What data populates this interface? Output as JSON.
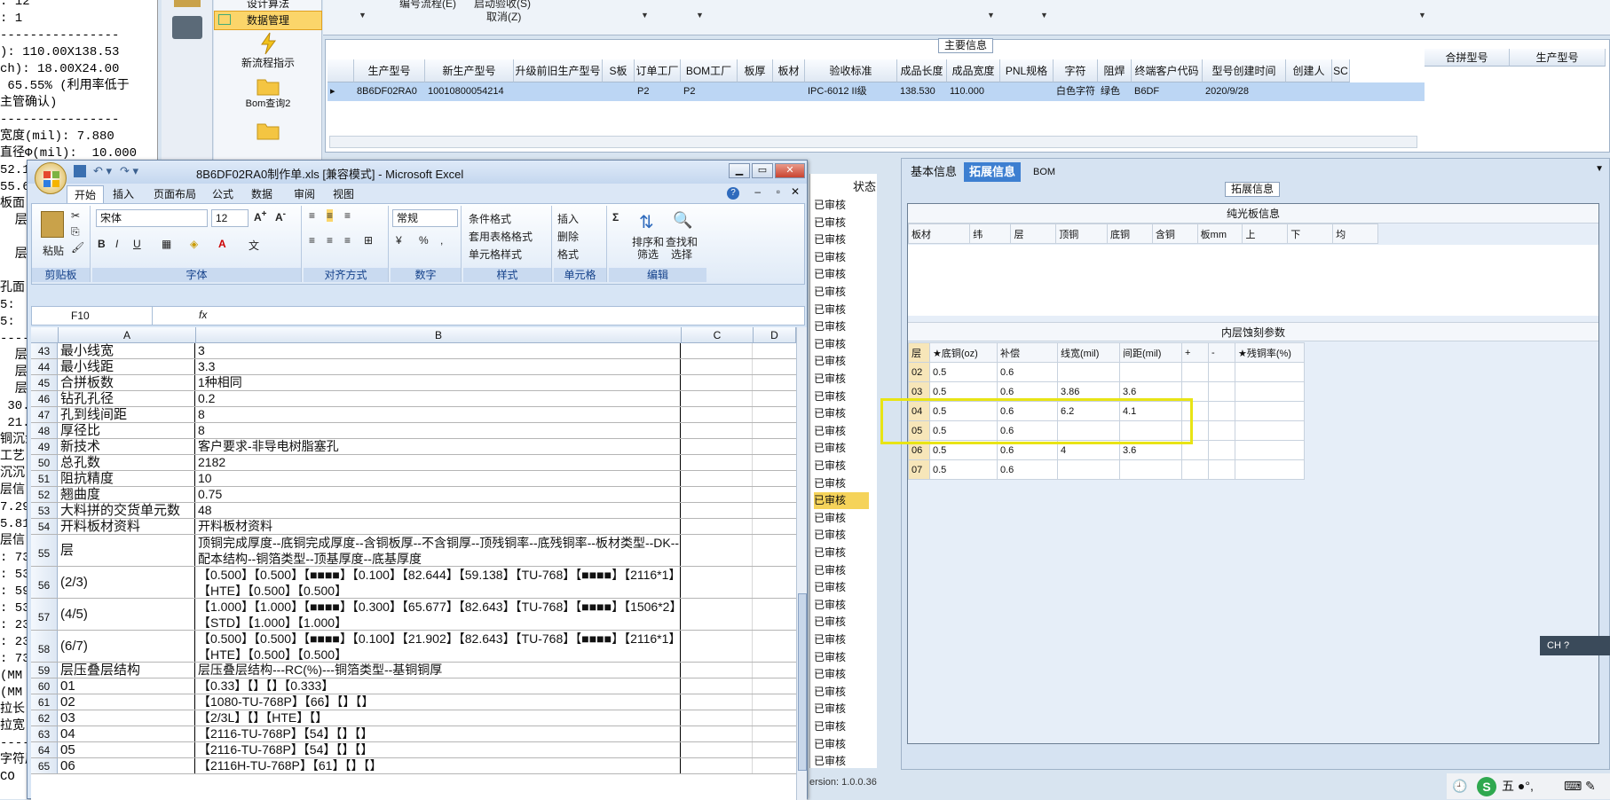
{
  "log": {
    "lines": [
      ": 12",
      ": 1",
      "----------------",
      "): 110.00X138.53",
      "ch): 18.00X24.00",
      " 65.55% (利用率低于",
      "主管确认)",
      "----------------",
      "宽度(mil): 7.880",
      "直径Φ(mil):  10.000",
      "52.1",
      "55.6",
      "板面",
      "  层",
      "",
      "  层",
      "",
      "孔面",
      "5:",
      "5:",
      "----",
      "  层",
      "  层",
      "  层",
      " 30.",
      " 21.",
      "铜沉金",
      "工艺",
      "沉沉",
      "层信",
      "7.29",
      "5.81",
      "层信",
      ": 73",
      ": 53",
      ": 59",
      ": 53",
      ": 23",
      ": 23",
      ": 73",
      "(MM",
      "(MM",
      "拉长",
      "拉宽",
      "----",
      "字符层",
      "CO"
    ]
  },
  "nav": {
    "items": [
      {
        "label": "设计算法"
      },
      {
        "label": "数据管理"
      },
      {
        "label": "新流程指示"
      },
      {
        "label": "Bom查询2"
      }
    ]
  },
  "toolbar": {
    "item1": "编号流程(E)",
    "item2": "启动验收(S)",
    "item3": "取消(Z)"
  },
  "main": {
    "section_title": "主要信息",
    "columns": [
      "生产型号",
      "新生产型号",
      "升级前旧生产型号",
      "S板",
      "订单工厂",
      "BOM工厂",
      "板厚",
      "板材",
      "验收标准",
      "成品长度",
      "成品宽度",
      "PNL规格",
      "字符",
      "阻焊",
      "终端客户代码",
      "型号创建时间",
      "创建人",
      "SC"
    ],
    "row": [
      "8B6DF02RA0",
      "10010800054214",
      "",
      "",
      "P2",
      "P2",
      "",
      "",
      "IPC-6012 II级",
      "138.530",
      "110.000",
      "",
      "白色字符",
      "绿色",
      "B6DF",
      "2020/9/28",
      "",
      ""
    ],
    "side_columns": [
      "合拼型号",
      "生产型号"
    ]
  },
  "status": {
    "header": "状态",
    "items": [
      "已审核",
      "已审核",
      "已审核",
      "已审核",
      "已审核",
      "已审核",
      "已审核",
      "已审核",
      "已审核",
      "已审核",
      "已审核",
      "已审核",
      "已审核",
      "已审核",
      "已审核",
      "已审核",
      "已审核",
      "已审核",
      "已审核",
      "已审核",
      "已审核",
      "已审核",
      "已审核",
      "已审核",
      "已审核",
      "已审核",
      "已审核",
      "已审核",
      "已审核",
      "已审核",
      "已审核",
      "已审核",
      "已审核"
    ],
    "version": "ersion: 1.0.0.36"
  },
  "detail": {
    "tabs": [
      "基本信息",
      "拓展信息",
      "BOM"
    ],
    "group_title": "拓展信息",
    "plain": {
      "title": "纯光板信息",
      "columns": [
        "板材",
        "纬",
        "层",
        "顶铜",
        "底铜",
        "含铜",
        "板mm",
        "上",
        "下",
        "均"
      ]
    },
    "inner": {
      "title": "内层蚀刻参数",
      "columns": [
        "层",
        "★底铜(oz)",
        "补偿",
        "线宽(mil)",
        "间距(mil)",
        "+",
        "-",
        "★残铜率(%)"
      ],
      "rows": [
        [
          "02",
          "0.5",
          "0.6",
          "",
          "",
          "",
          "",
          ""
        ],
        [
          "03",
          "0.5",
          "0.6",
          "3.86",
          "3.6",
          "",
          "",
          ""
        ],
        [
          "04",
          "0.5",
          "0.6",
          "6.2",
          "4.1",
          "",
          "",
          ""
        ],
        [
          "05",
          "0.5",
          "0.6",
          "",
          "",
          "",
          "",
          ""
        ],
        [
          "06",
          "0.5",
          "0.6",
          "4",
          "3.6",
          "",
          "",
          ""
        ],
        [
          "07",
          "0.5",
          "0.6",
          "",
          "",
          "",
          "",
          ""
        ]
      ]
    }
  },
  "excel": {
    "title": "8B6DF02RA0制作单.xls  [兼容模式] - Microsoft Excel",
    "tabs": [
      "开始",
      "插入",
      "页面布局",
      "公式",
      "数据",
      "审阅",
      "视图"
    ],
    "ribbon": {
      "clipboard": "剪贴板",
      "paste": "粘贴",
      "font_group": "字体",
      "font_name": "宋体",
      "font_size": "12",
      "align_group": "对齐方式",
      "number_group": "数字",
      "number_format": "常规",
      "styles_group": "样式",
      "cond_format": "条件格式",
      "table_format": "套用表格格式",
      "cell_style": "单元格样式",
      "cells_group": "单元格",
      "insert": "插入",
      "delete": "删除",
      "format": "格式",
      "edit_group": "编辑",
      "sort": "排序和\n筛选",
      "find": "查找和\n选择"
    },
    "namebox": "F10",
    "fx": "fx",
    "col_headers": [
      "A",
      "B",
      "C",
      "D"
    ],
    "rows": [
      {
        "n": "43",
        "a": "最小线宽",
        "b": "3"
      },
      {
        "n": "44",
        "a": "最小线距",
        "b": "3.3"
      },
      {
        "n": "45",
        "a": "合拼板数",
        "b": "1种相同"
      },
      {
        "n": "46",
        "a": "钻孔孔径",
        "b": "0.2"
      },
      {
        "n": "47",
        "a": "孔到线间距",
        "b": "8"
      },
      {
        "n": "48",
        "a": "厚径比",
        "b": "8"
      },
      {
        "n": "49",
        "a": "新技术",
        "b": "客户要求-非导电树脂塞孔"
      },
      {
        "n": "50",
        "a": "总孔数",
        "b": "2182"
      },
      {
        "n": "51",
        "a": "阻抗精度",
        "b": "10"
      },
      {
        "n": "52",
        "a": "翘曲度",
        "b": "0.75"
      },
      {
        "n": "53",
        "a": "大料拼的交货单元数",
        "b": "48"
      },
      {
        "n": "54",
        "a": "开料板材资料",
        "b": "开料板材资料"
      },
      {
        "n": "55",
        "a": "层",
        "b": "顶铜完成厚度--底铜完成厚度--含铜板厚--不含铜厚--顶残铜率--底残铜率--板材类型--DK--配本结构--铜箔类型--顶基厚度--底基厚度"
      },
      {
        "n": "56",
        "a": "(2/3)",
        "b": "【0.500】【0.500】【■■■■】【0.100】【82.644】【59.138】【TU-768】【■■■■】【2116*1】【HTE】【0.500】【0.500】"
      },
      {
        "n": "57",
        "a": "(4/5)",
        "b": "【1.000】【1.000】【■■■■】【0.300】【65.677】【82.643】【TU-768】【■■■■】【1506*2】【STD】【1.000】【1.000】"
      },
      {
        "n": "58",
        "a": "(6/7)",
        "b": "【0.500】【0.500】【■■■■】【0.100】【21.902】【82.643】【TU-768】【■■■■】【2116*1】【HTE】【0.500】【0.500】"
      },
      {
        "n": "59",
        "a": "层压叠层结构",
        "b": "层压叠层结构---RC(%)---铜箔类型--基铜铜厚"
      },
      {
        "n": "60",
        "a": "01",
        "b": "【0.33】【】【】【0.333】"
      },
      {
        "n": "61",
        "a": "02",
        "b": "【1080-TU-768P】【66】【】【】"
      },
      {
        "n": "62",
        "a": "03",
        "b": "【2/3L】【】【HTE】【】"
      },
      {
        "n": "63",
        "a": "04",
        "b": "【2116-TU-768P】【54】【】【】"
      },
      {
        "n": "64",
        "a": "05",
        "b": "【2116-TU-768P】【54】【】【】"
      },
      {
        "n": "65",
        "a": "06",
        "b": "【2116H-TU-768P】【61】【】【】"
      }
    ]
  },
  "tray": {
    "ime": "CH",
    "text": "五 ●°,"
  }
}
